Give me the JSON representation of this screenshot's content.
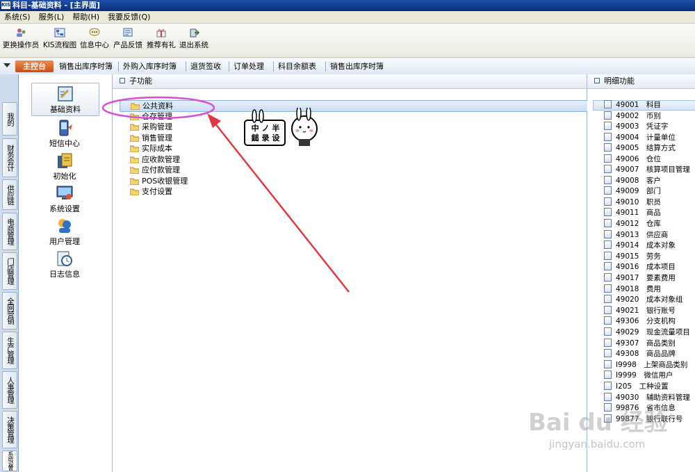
{
  "window": {
    "title": "科目-基础资料 - [主界面]",
    "logo": "KIS"
  },
  "menu": [
    "系统(S)",
    "服务(L)",
    "帮助(H)",
    "我要反馈(Q)"
  ],
  "toolbar": [
    {
      "label": "更换操作员",
      "icon": "change-operator-icon"
    },
    {
      "label": "KIS流程图",
      "icon": "flowchart-icon"
    },
    {
      "label": "信息中心",
      "icon": "message-center-icon"
    },
    {
      "label": "产品反馈",
      "icon": "feedback-icon"
    },
    {
      "label": "推荐有礼",
      "icon": "gift-icon"
    },
    {
      "label": "退出系统",
      "icon": "exit-icon"
    }
  ],
  "tabs": {
    "home": "主控台",
    "items": [
      "销售出库序时簿",
      "外购入库序时簿",
      "退货签收",
      "订单处理",
      "科目余额表",
      "销售出库序时簿"
    ]
  },
  "vertical_tabs": [
    "我的KIS",
    "财务会计",
    "供应链",
    "电商管理",
    "门店管理",
    "全网营销",
    "生产管理",
    "人事管理",
    "决策管理",
    "系统设置"
  ],
  "left_nav": [
    {
      "label": "基础资料",
      "icon": "basic-data-icon",
      "selected": true
    },
    {
      "label": "短信中心",
      "icon": "sms-center-icon"
    },
    {
      "label": "初始化",
      "icon": "initialize-icon"
    },
    {
      "label": "系统设置",
      "icon": "system-settings-icon"
    },
    {
      "label": "用户管理",
      "icon": "user-management-icon"
    },
    {
      "label": "日志信息",
      "icon": "log-info-icon"
    }
  ],
  "sub_functions": {
    "header": "子功能",
    "items": [
      "公共资料",
      "仓存管理",
      "采购管理",
      "销售管理",
      "实际成本",
      "应收款管理",
      "应付款管理",
      "POS收银管理",
      "支付设置"
    ]
  },
  "details": {
    "header": "明细功能",
    "items": [
      "49001　科目",
      "49002　币别",
      "49003　凭证字",
      "49004　计量单位",
      "49005　结算方式",
      "49006　仓位",
      "49007　核算项目管理",
      "49008　客户",
      "49009　部门",
      "49010　职员",
      "49011　商品",
      "49012　仓库",
      "49013　供应商",
      "49014　成本对象",
      "49015　劳务",
      "49016　成本项目",
      "49017　要素费用",
      "49018　费用",
      "49020　成本对象组",
      "49021　银行账号",
      "49306　分支机构",
      "49029　现金流量项目",
      "49307　商品类别",
      "49308　商品品牌",
      "I9998　上架商品类别",
      "I9999　微信用户",
      "I205　工种设置",
      "49030　辅助资料管理",
      "99876　省市信息",
      "99877　银行联行号"
    ]
  },
  "sticker": {
    "line1": "中 ノ 半",
    "line2": "鎚 录 设"
  },
  "watermark": {
    "brand": "Bai du 经验",
    "url": "jingyan.baidu.com"
  },
  "colors": {
    "titlebar": "#0a2f7e",
    "home_tab": "#d9601f",
    "annotation": "#e0383e",
    "highlight_ellipse": "#d64fd6"
  }
}
